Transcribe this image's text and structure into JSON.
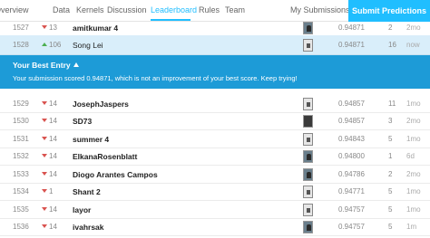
{
  "nav": {
    "tabs": [
      {
        "label": "Overview"
      },
      {
        "label": "Data"
      },
      {
        "label": "Kernels"
      },
      {
        "label": "Discussion"
      },
      {
        "label": "Leaderboard"
      },
      {
        "label": "Rules"
      },
      {
        "label": "Team"
      }
    ],
    "active_tab": "Leaderboard",
    "my_submissions": "My Submissions",
    "submit_predictions": "Submit Predictions"
  },
  "rows_top": [
    {
      "rank": "1527",
      "change": "13",
      "direction": "down",
      "name": "amitkumar 4",
      "score": "0.94871",
      "entries": "2",
      "last": "2mo"
    },
    {
      "rank": "1528",
      "change": "106",
      "direction": "up",
      "name": "Song Lei",
      "score": "0.94871",
      "entries": "16",
      "last": "now"
    }
  ],
  "best_entry": {
    "title": "Your Best Entry",
    "message": "Your submission scored 0.94871, which is not an improvement of your best score. Keep trying!"
  },
  "rows": [
    {
      "rank": "1529",
      "change": "14",
      "direction": "down",
      "name": "JosephJaspers",
      "score": "0.94857",
      "entries": "11",
      "last": "1mo"
    },
    {
      "rank": "1530",
      "change": "14",
      "direction": "down",
      "name": "SD73",
      "score": "0.94857",
      "entries": "3",
      "last": "2mo"
    },
    {
      "rank": "1531",
      "change": "14",
      "direction": "down",
      "name": "summer 4",
      "score": "0.94843",
      "entries": "5",
      "last": "1mo"
    },
    {
      "rank": "1532",
      "change": "14",
      "direction": "down",
      "name": "ElkanaRosenblatt",
      "score": "0.94800",
      "entries": "1",
      "last": "6d"
    },
    {
      "rank": "1533",
      "change": "14",
      "direction": "down",
      "name": "Diogo Arantes Campos",
      "score": "0.94786",
      "entries": "2",
      "last": "2mo"
    },
    {
      "rank": "1534",
      "change": "1",
      "direction": "down",
      "name": "Shant 2",
      "score": "0.94771",
      "entries": "5",
      "last": "1mo"
    },
    {
      "rank": "1535",
      "change": "14",
      "direction": "down",
      "name": "layor",
      "score": "0.94757",
      "entries": "5",
      "last": "1mo"
    },
    {
      "rank": "1536",
      "change": "14",
      "direction": "down",
      "name": "ivahrsak",
      "score": "0.94757",
      "entries": "5",
      "last": "1m"
    }
  ]
}
